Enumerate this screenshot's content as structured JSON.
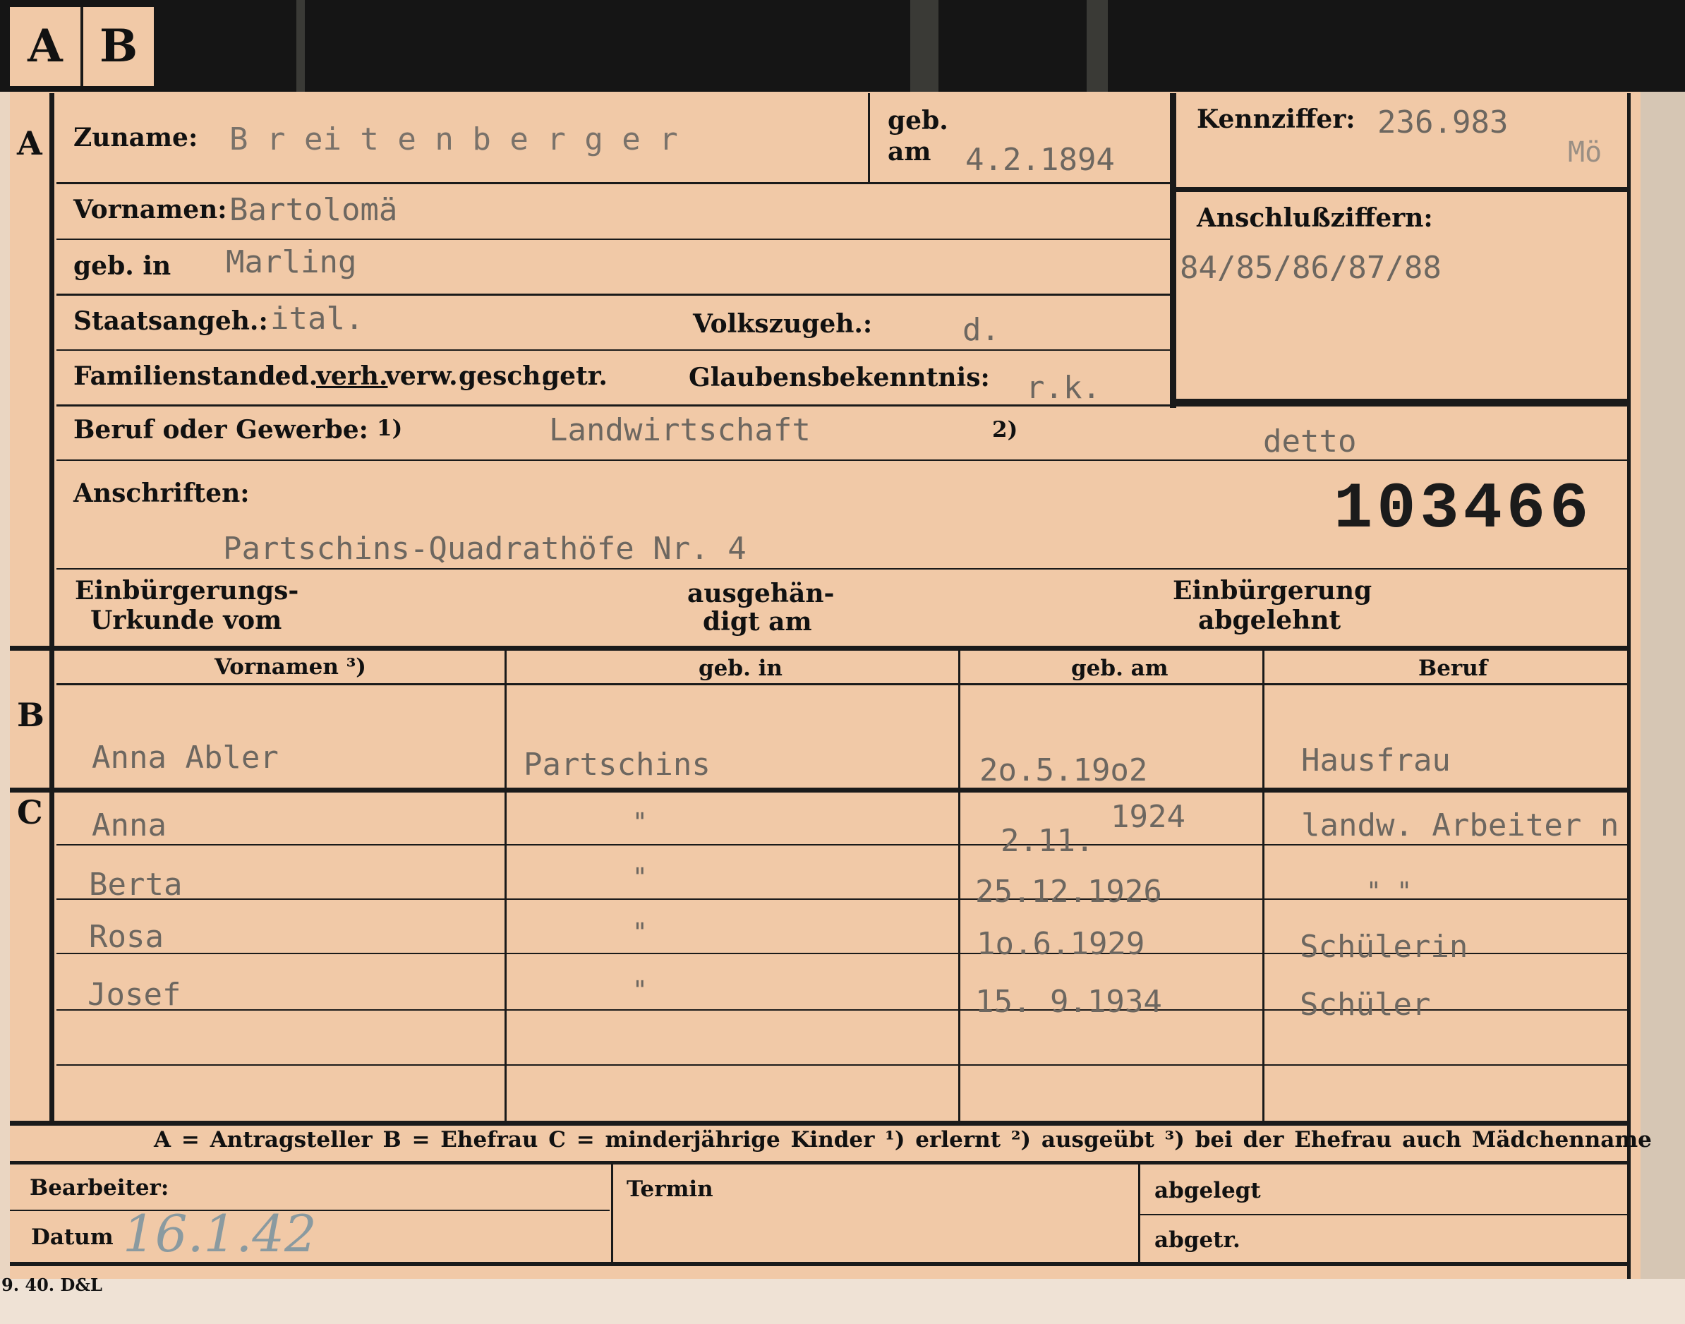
{
  "tabs": [
    "A",
    "B"
  ],
  "sections": {
    "a": "A",
    "b": "B",
    "c": "C"
  },
  "labels": {
    "zuname": "Zuname:",
    "geb": "geb.",
    "am": "am",
    "kennziffer": "Kennziffer:",
    "vornamen": "Vornamen:",
    "anschlussziffern": "Anschlußziffern:",
    "geb_in": "geb. in",
    "staatsangeh": "Staatsangeh.:",
    "volkszugeh": "Volkszugeh.:",
    "familienstand": "Familienstand:",
    "fam_options": [
      "led.",
      "verh.",
      "verw.",
      "gesch.",
      "getr."
    ],
    "glaubensbekenntnis": "Glaubensbekenntnis:",
    "beruf": "Beruf oder Gewerbe:",
    "mark1": "1)",
    "mark2": "2)",
    "anschriften": "Anschriften:",
    "einbuergerungsurkunde_1": "Einbürgerungs-",
    "einbuergerungsurkunde_2": "Urkunde vom",
    "ausgehaendigt_1": "ausgehän-",
    "ausgehaendigt_2": "digt am",
    "einbuergerung_abgelehnt_1": "Einbürgerung",
    "einbuergerung_abgelehnt_2": "abgelehnt",
    "bearbeiter": "Bearbeiter:",
    "datum": "Datum",
    "termin": "Termin",
    "abgelegt": "abgelegt",
    "abgetr": "abgetr.",
    "print_mark": "9. 40. D&L"
  },
  "person": {
    "zuname": "B r ei t e n b e r g e r",
    "geb_am": "4.2.1894",
    "kennziffer": "236.983",
    "kennziffer_suffix": "Mö",
    "vornamen": "Bartolomä",
    "anschlussziffern": "84/85/86/87/88",
    "geb_in": "Marling",
    "staatsangeh": "ital.",
    "volkszugeh": "d.",
    "glaubensbekenntnis": "r.k.",
    "beruf_erlernt": "Landwirtschaft",
    "beruf_ausgeuebt": "detto",
    "anschrift": "Partschins-Quadrathöfe Nr. 4",
    "stamp_number": "103466"
  },
  "table": {
    "headers": [
      "Vornamen ³)",
      "geb. in",
      "geb. am",
      "Beruf"
    ],
    "spouse": {
      "name": "Anna Abler",
      "place": "Partschins",
      "date": "2o.5.19o2",
      "occupation": "Hausfrau"
    },
    "children": [
      {
        "name": "Anna",
        "place": "\"",
        "date": "2.11.",
        "date_extra": "1924",
        "occupation": "landw. Arbeiter n"
      },
      {
        "name": "Berta",
        "place": "\"",
        "date": "25.12.1926",
        "occupation": "\"          \""
      },
      {
        "name": "Rosa",
        "place": "\"",
        "date": "1o.6.1929",
        "occupation": "Schülerin"
      },
      {
        "name": "Josef",
        "place": "\"",
        "date": "15. 9.1934",
        "occupation": "Schüler"
      }
    ]
  },
  "legend": "A = Antragsteller   B = Ehefrau   C = minderjährige Kinder   ¹) erlernt   ²) ausgeübt   ³) bei der Ehefrau auch Mädchenname",
  "datum_value": "16.1.42",
  "colors": {
    "card": "#f1c9a7",
    "ink": "#111111",
    "typewriter": "#6d6760",
    "background_top": "#151515"
  }
}
